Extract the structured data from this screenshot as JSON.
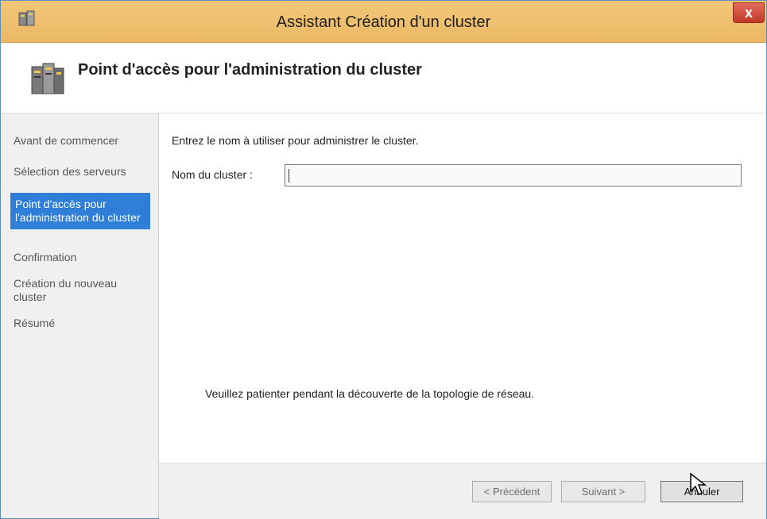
{
  "window": {
    "title": "Assistant Création d'un cluster",
    "close_glyph": "x"
  },
  "header": {
    "title": "Point d'accès pour l'administration du cluster"
  },
  "steps": [
    {
      "label": "Avant de commencer",
      "active": false
    },
    {
      "label": "Sélection des serveurs",
      "active": false
    },
    {
      "label": "Point d'accès pour l'administration du cluster",
      "active": true
    },
    {
      "label": "Confirmation",
      "active": false
    },
    {
      "label": "Création du nouveau cluster",
      "active": false
    },
    {
      "label": "Résumé",
      "active": false
    }
  ],
  "content": {
    "instruction": "Entrez le nom à utiliser pour administrer le cluster.",
    "cluster_label": "Nom du cluster :",
    "cluster_value": "",
    "wait_message": "Veuillez patienter pendant la découverte de la topologie de réseau."
  },
  "footer": {
    "prev_label": "< Précédent",
    "next_label": "Suivant >",
    "cancel_label": "Annuler"
  },
  "colors": {
    "titlebar": "#eab866",
    "active_step": "#2f7ed8",
    "close": "#c03a2a"
  },
  "icons": [
    "wizard-app-icon",
    "cluster-servers-icon",
    "close-icon",
    "mouse-cursor-icon"
  ]
}
